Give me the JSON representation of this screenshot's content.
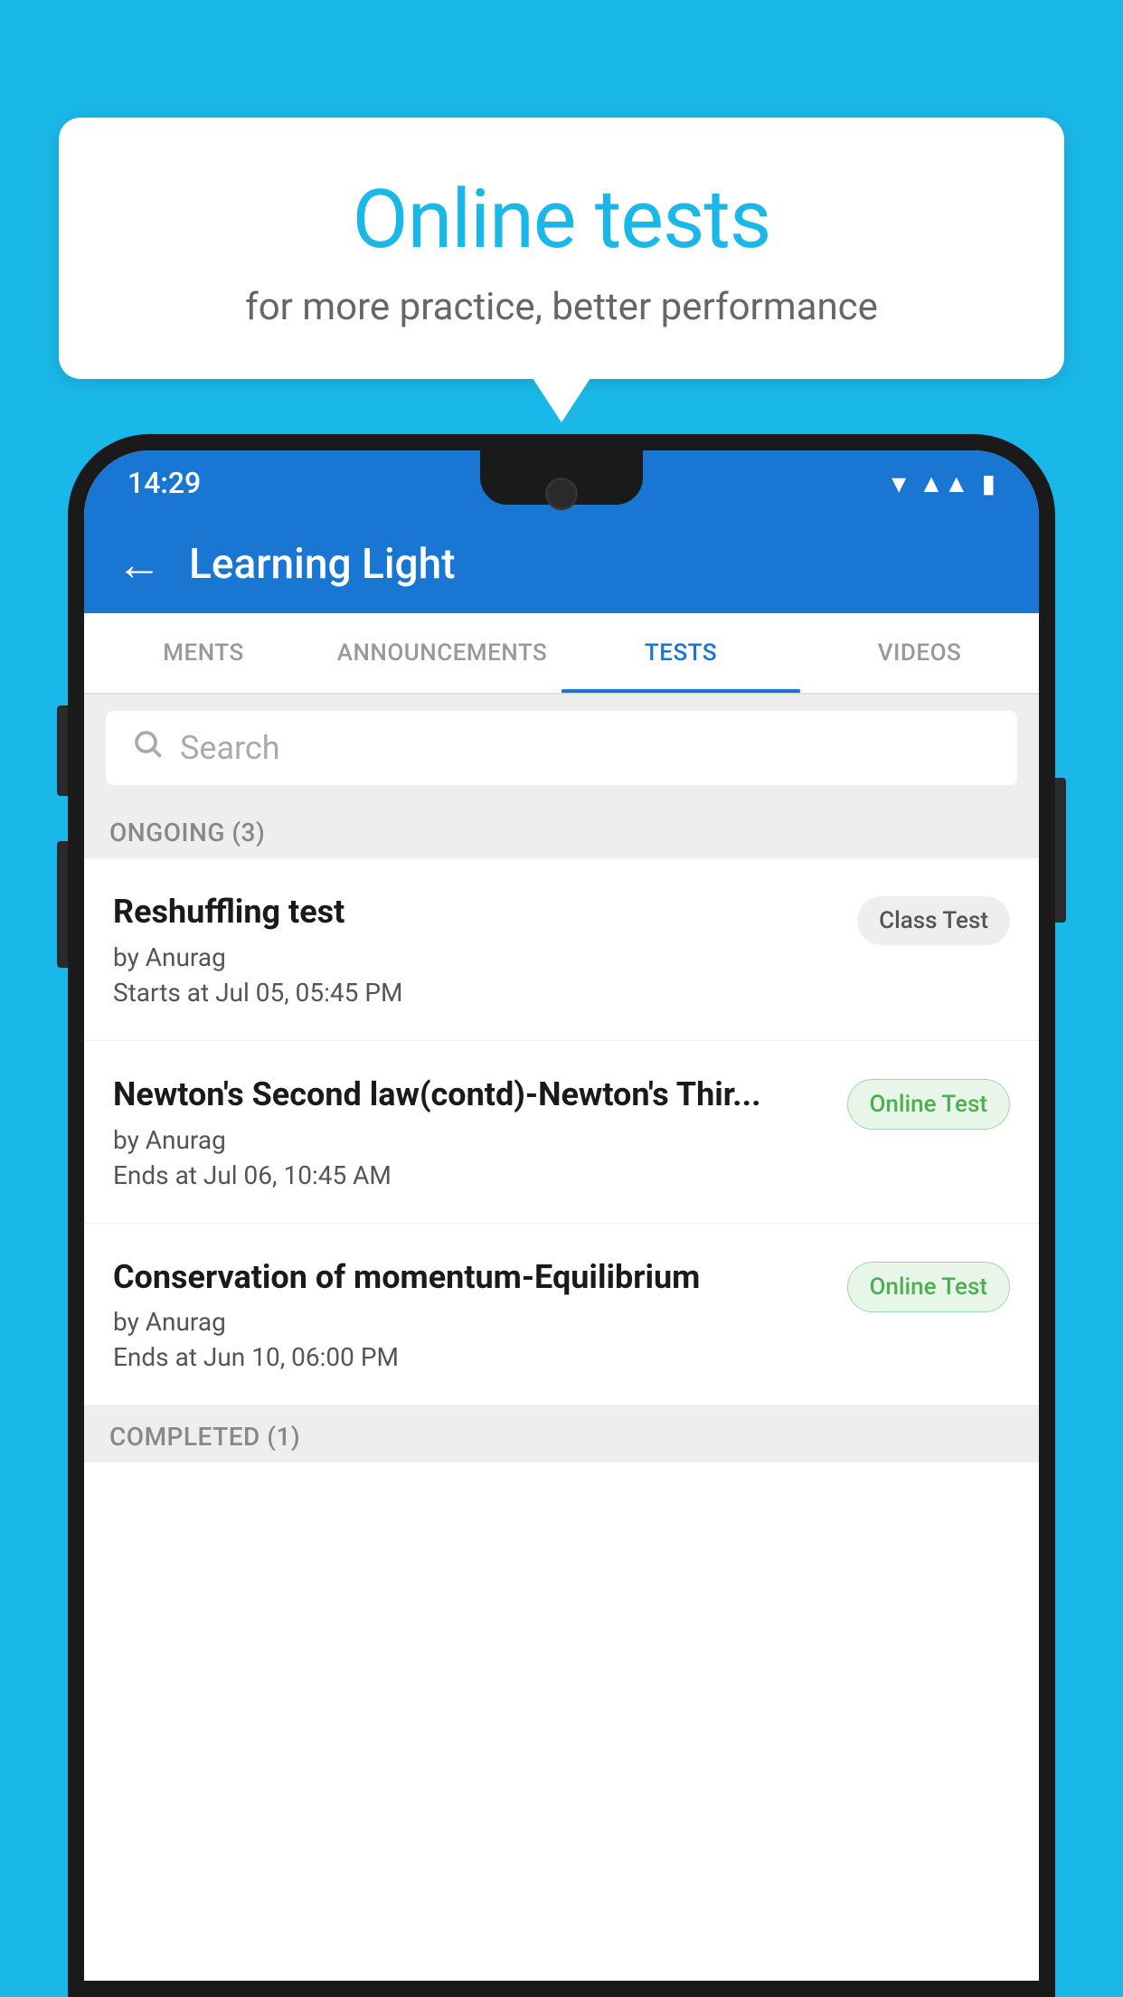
{
  "background_color": "#1ab8e8",
  "speech_bubble": {
    "title": "Online tests",
    "subtitle": "for more practice, better performance"
  },
  "phone": {
    "status_bar": {
      "time": "14:29",
      "icons": [
        "wifi",
        "signal",
        "battery"
      ]
    },
    "app_bar": {
      "title": "Learning Light",
      "back_label": "←"
    },
    "tabs": [
      {
        "label": "MENTS",
        "active": false
      },
      {
        "label": "ANNOUNCEMENTS",
        "active": false
      },
      {
        "label": "TESTS",
        "active": true
      },
      {
        "label": "VIDEOS",
        "active": false
      }
    ],
    "search": {
      "placeholder": "Search"
    },
    "ongoing_section": {
      "label": "ONGOING (3)"
    },
    "test_items": [
      {
        "title": "Reshuffling test",
        "author": "by Anurag",
        "time_label": "Starts at",
        "time_value": "Jul 05, 05:45 PM",
        "badge": "Class Test",
        "badge_type": "class"
      },
      {
        "title": "Newton's Second law(contd)-Newton's Thir...",
        "author": "by Anurag",
        "time_label": "Ends at",
        "time_value": "Jul 06, 10:45 AM",
        "badge": "Online Test",
        "badge_type": "online"
      },
      {
        "title": "Conservation of momentum-Equilibrium",
        "author": "by Anurag",
        "time_label": "Ends at",
        "time_value": "Jun 10, 06:00 PM",
        "badge": "Online Test",
        "badge_type": "online"
      }
    ],
    "completed_section": {
      "label": "COMPLETED (1)"
    }
  }
}
